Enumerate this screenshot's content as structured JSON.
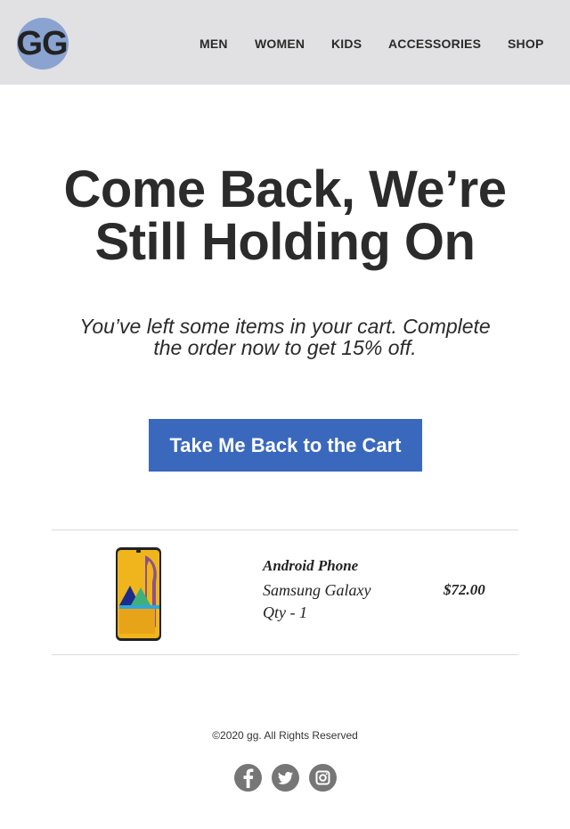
{
  "header": {
    "logo_text": "GG",
    "nav": [
      {
        "label": "MEN"
      },
      {
        "label": "WOMEN"
      },
      {
        "label": "KIDS"
      },
      {
        "label": "ACCESSORIES"
      },
      {
        "label": "SHOP"
      }
    ]
  },
  "hero": {
    "headline_line1": "Come Back, We’re",
    "headline_line2": "Still Holding On",
    "subtext_line1": "You’ve left some items in your cart. Complete",
    "subtext_line2": "the order now to get 15% off.",
    "cta_label": "Take Me Back to the Cart"
  },
  "cart_item": {
    "image_icon": "smartphone-image",
    "title": "Android Phone",
    "name": "Samsung Galaxy",
    "qty": "Qty - 1",
    "price": "$72.00"
  },
  "footer": {
    "copyright": "©2020 gg. All Rights Reserved",
    "social": [
      "facebook-icon",
      "twitter-icon",
      "instagram-icon"
    ]
  },
  "colors": {
    "header_bg": "#e1e1e3",
    "logo_bg": "#8aa3d1",
    "cta_bg": "#3a68bd",
    "social_icon_bg": "#767676"
  }
}
